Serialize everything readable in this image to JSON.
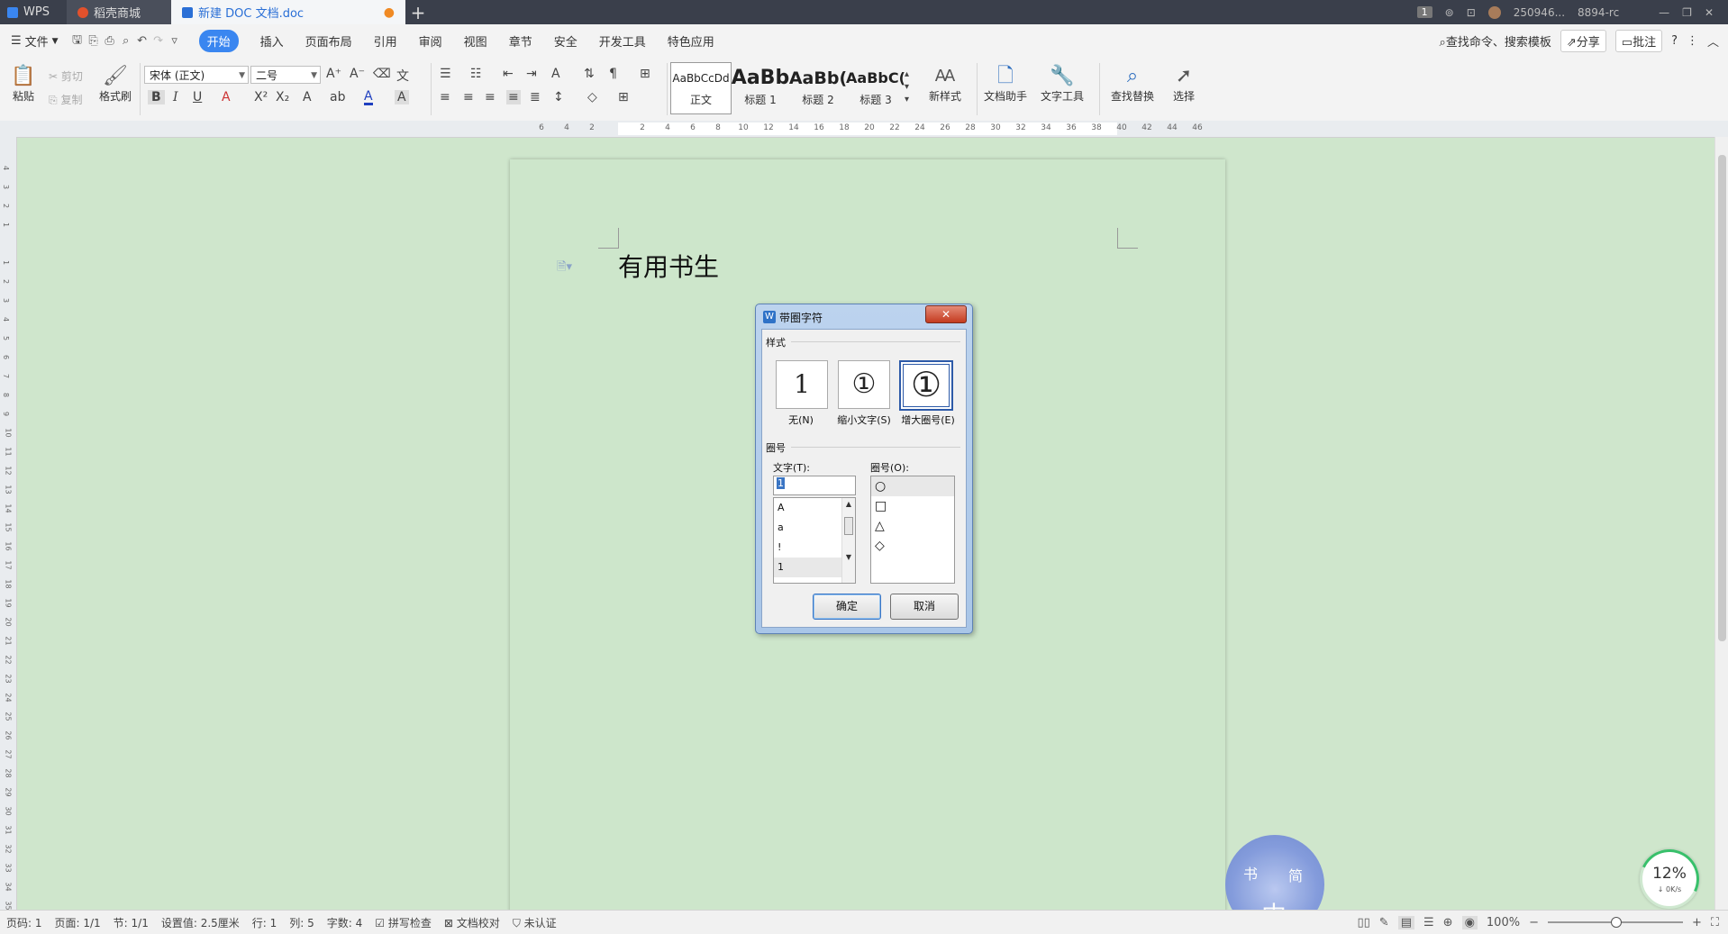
{
  "titlebar": {
    "tabs": [
      {
        "label": "WPS"
      },
      {
        "label": "稻壳商城"
      },
      {
        "label": "新建 DOC 文档.doc"
      }
    ],
    "badge": "1",
    "user": "250946...",
    "user_extra": "8894-rc"
  },
  "menubar": {
    "file_label": "文件",
    "items": [
      "开始",
      "插入",
      "页面布局",
      "引用",
      "审阅",
      "视图",
      "章节",
      "安全",
      "开发工具",
      "特色应用"
    ],
    "search": "查找命令、搜索模板",
    "share": "分享",
    "comment": "批注"
  },
  "ribbon": {
    "paste": "粘贴",
    "cut": "剪切",
    "copy": "复制",
    "format_painter": "格式刷",
    "font_name": "宋体 (正文)",
    "font_size": "二号",
    "styles": [
      {
        "preview": "AaBbCcDd",
        "label": "正文"
      },
      {
        "preview": "AaBb",
        "label": "标题 1"
      },
      {
        "preview": "AaBb(",
        "label": "标题 2"
      },
      {
        "preview": "AaBbC(",
        "label": "标题 3"
      }
    ],
    "new_style": "新样式",
    "doc_assistant": "文档助手",
    "text_tools": "文字工具",
    "find_replace": "查找替换",
    "select": "选择"
  },
  "ruler": {
    "ticks": [
      "6",
      "4",
      "2",
      "",
      "2",
      "4",
      "6",
      "8",
      "10",
      "12",
      "14",
      "16",
      "18",
      "20",
      "22",
      "24",
      "26",
      "28",
      "30",
      "32",
      "34",
      "36",
      "38",
      "40",
      "42",
      "44",
      "46"
    ],
    "vticks": [
      "4",
      "3",
      "2",
      "1",
      "",
      "1",
      "2",
      "3",
      "4",
      "5",
      "6",
      "7",
      "8",
      "9",
      "10",
      "11",
      "12",
      "13",
      "14",
      "15",
      "16",
      "17",
      "18",
      "19",
      "20",
      "21",
      "22",
      "23",
      "24",
      "25",
      "26",
      "27",
      "28",
      "29",
      "30",
      "31",
      "32",
      "33",
      "34",
      "35"
    ]
  },
  "document": {
    "text": "有用书生"
  },
  "dialog": {
    "title": "带圈字符",
    "close": "✕",
    "style_group": "样式",
    "options": [
      {
        "glyph": "1",
        "label": "无(N)"
      },
      {
        "glyph": "①",
        "label": "缩小文字(S)"
      },
      {
        "glyph": "①",
        "label": "增大圈号(E)"
      }
    ],
    "enclosure_group": "圈号",
    "text_label": "文字(T):",
    "text_value": "1",
    "text_list": [
      "A",
      "a",
      "!",
      "1"
    ],
    "enclosure_label": "圈号(O):",
    "enclosure_list": [
      "○",
      "□",
      "△",
      "◇"
    ],
    "ok": "确定",
    "cancel": "取消"
  },
  "statusbar": {
    "items": [
      "页码: 1",
      "页面: 1/1",
      "节: 1/1",
      "设置值: 2.5厘米",
      "行: 1",
      "列: 5",
      "字数: 4",
      "拼写检查",
      "文档校对",
      "未认证"
    ],
    "zoom": "100%"
  },
  "widget": {
    "percent": "12%",
    "speed": "↓ 0K/s"
  },
  "watermark": {
    "chars": [
      "中",
      "简",
      "书"
    ]
  }
}
